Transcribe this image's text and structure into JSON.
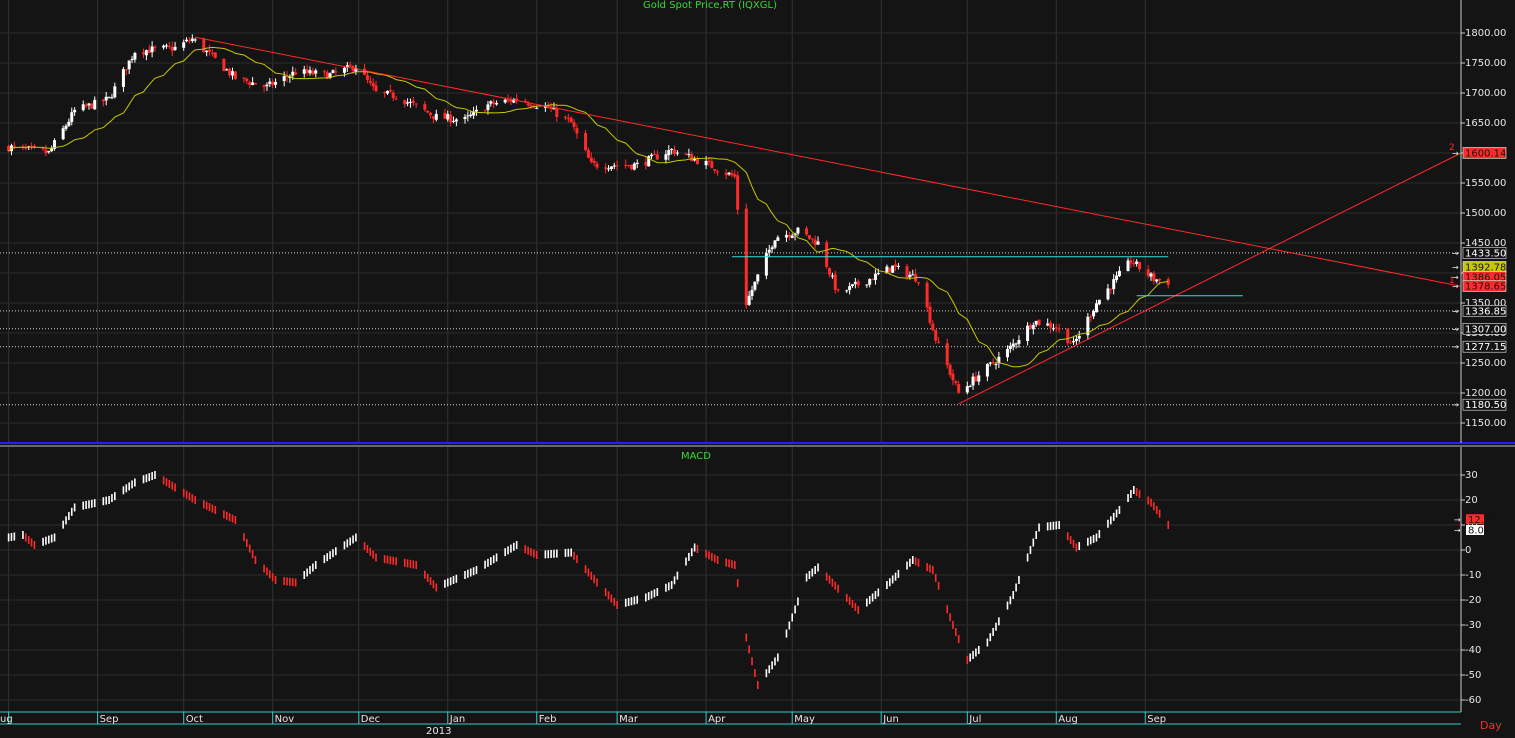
{
  "chart_data": [
    {
      "type": "candlestick",
      "title": "Gold  Spot  Price,RT  (IQXGL)",
      "ylim": [
        1110,
        1830
      ],
      "yticks": [
        1150,
        1200,
        1250,
        1300,
        1350,
        1400,
        1450,
        1500,
        1550,
        1600,
        1650,
        1700,
        1750,
        1800
      ],
      "ytick_labels": [
        "1150.00",
        "1200.00",
        "1250.00",
        "1300.00",
        "1350.00",
        "1400.00",
        "1450.00",
        "1500.00",
        "1550.00",
        "1600.00",
        "1650.00",
        "1700.00",
        "1750.00",
        "1800.00"
      ],
      "x_months": [
        "Aug",
        "Sep",
        "Oct",
        "Nov",
        "Dec",
        "Jan",
        "Feb",
        "Mar",
        "Apr",
        "May",
        "Jun",
        "Jul",
        "Aug",
        "Sep"
      ],
      "year_label": "2013",
      "moving_average_color": "#c8c800",
      "up_color": "#ffffff",
      "down_color": "#ff2a2a",
      "trendline_color": "#ff2a2a",
      "level_line_color": "#33dddd",
      "key_points": [
        {
          "date": "2012-08-01",
          "close": 1610
        },
        {
          "date": "2012-08-15",
          "close": 1600
        },
        {
          "date": "2012-08-24",
          "close": 1670
        },
        {
          "date": "2012-09-05",
          "close": 1690
        },
        {
          "date": "2012-09-14",
          "close": 1770
        },
        {
          "date": "2012-09-28",
          "close": 1775
        },
        {
          "date": "2012-10-04",
          "close": 1790
        },
        {
          "date": "2012-10-19",
          "close": 1725
        },
        {
          "date": "2012-10-30",
          "close": 1710
        },
        {
          "date": "2012-11-09",
          "close": 1735
        },
        {
          "date": "2012-11-21",
          "close": 1730
        },
        {
          "date": "2012-11-30",
          "close": 1745
        },
        {
          "date": "2012-12-07",
          "close": 1700
        },
        {
          "date": "2012-12-14",
          "close": 1695
        },
        {
          "date": "2012-12-28",
          "close": 1660
        },
        {
          "date": "2013-01-07",
          "close": 1655
        },
        {
          "date": "2013-01-15",
          "close": 1680
        },
        {
          "date": "2013-01-25",
          "close": 1690
        },
        {
          "date": "2013-02-05",
          "close": 1675
        },
        {
          "date": "2013-02-13",
          "close": 1650
        },
        {
          "date": "2013-02-20",
          "close": 1580
        },
        {
          "date": "2013-02-28",
          "close": 1580
        },
        {
          "date": "2013-03-08",
          "close": 1580
        },
        {
          "date": "2013-03-20",
          "close": 1605
        },
        {
          "date": "2013-04-02",
          "close": 1580
        },
        {
          "date": "2013-04-11",
          "close": 1560
        },
        {
          "date": "2013-04-15",
          "close": 1350
        },
        {
          "date": "2013-04-25",
          "close": 1460
        },
        {
          "date": "2013-05-03",
          "close": 1470
        },
        {
          "date": "2013-05-10",
          "close": 1450
        },
        {
          "date": "2013-05-17",
          "close": 1365
        },
        {
          "date": "2013-05-28",
          "close": 1390
        },
        {
          "date": "2013-06-05",
          "close": 1410
        },
        {
          "date": "2013-06-14",
          "close": 1390
        },
        {
          "date": "2013-06-20",
          "close": 1290
        },
        {
          "date": "2013-06-28",
          "close": 1200
        },
        {
          "date": "2013-07-05",
          "close": 1230
        },
        {
          "date": "2013-07-15",
          "close": 1270
        },
        {
          "date": "2013-07-24",
          "close": 1320
        },
        {
          "date": "2013-08-01",
          "close": 1310
        },
        {
          "date": "2013-08-07",
          "close": 1280
        },
        {
          "date": "2013-08-15",
          "close": 1350
        },
        {
          "date": "2013-08-27",
          "close": 1420
        },
        {
          "date": "2013-09-04",
          "close": 1390
        },
        {
          "date": "2013-09-09",
          "close": 1385
        }
      ],
      "trendlines": [
        {
          "label": "1",
          "from": {
            "date": "2012-10-05",
            "value": 1793
          },
          "to": {
            "date": "2013-12-20",
            "value": 1378
          },
          "end_label": "1"
        },
        {
          "label": "2",
          "from": {
            "date": "2013-06-28",
            "value": 1182
          },
          "to": {
            "date": "2013-12-20",
            "value": 1600
          },
          "end_label": "2"
        }
      ],
      "horizontal_levels": [
        {
          "value": 1433.5,
          "label": "1433.50",
          "style": "dotted",
          "box_fill": "#141414",
          "box_text": "#ffffff"
        },
        {
          "value": 1336.85,
          "label": "1336.85",
          "style": "dotted",
          "box_fill": "#141414",
          "box_text": "#ffffff"
        },
        {
          "value": 1307.0,
          "label": "1307.00",
          "style": "dotted",
          "box_fill": "#141414",
          "box_text": "#ffffff"
        },
        {
          "value": 1277.15,
          "label": "1277.15",
          "style": "dotted",
          "box_fill": "#141414",
          "box_text": "#ffffff"
        },
        {
          "value": 1180.5,
          "label": "1180.50",
          "style": "dotted",
          "box_fill": "#141414",
          "box_text": "#ffffff"
        }
      ],
      "cyan_levels": [
        {
          "value": 1427,
          "from": "2013-04-10",
          "to": "2013-09-09"
        },
        {
          "value": 1362,
          "from": "2013-08-29",
          "to": "2013-10-05"
        }
      ],
      "value_tags": [
        {
          "value": 1600.14,
          "label": "1600.14",
          "fill": "#ff2a2a",
          "text": "#141414"
        },
        {
          "value": 1392.78,
          "label": "1392.78",
          "fill": "#c8c800",
          "text": "#141414"
        },
        {
          "value": 1386.05,
          "label": "1386.05",
          "fill": "#ff2a2a",
          "text": "#141414"
        },
        {
          "value": 1378.65,
          "label": "1378.65",
          "fill": "#ff2a2a",
          "text": "#141414"
        }
      ]
    },
    {
      "type": "bar",
      "title": "MACD",
      "ylim": [
        -66,
        38
      ],
      "yticks": [
        -60,
        -50,
        -40,
        -30,
        -20,
        -10,
        0,
        10,
        20,
        30
      ],
      "ytick_labels": [
        "-60",
        "-50",
        "-40",
        "-30",
        "-20",
        "-10",
        "0",
        "10",
        "20",
        "30"
      ],
      "up_color": "#ffffff",
      "down_color": "#ff2a2a",
      "key_points": [
        {
          "date": "2012-08-01",
          "value": 5
        },
        {
          "date": "2012-08-06",
          "value": 6
        },
        {
          "date": "2012-08-10",
          "value": 2
        },
        {
          "date": "2012-08-17",
          "value": 5
        },
        {
          "date": "2012-08-24",
          "value": 17
        },
        {
          "date": "2012-09-05",
          "value": 20
        },
        {
          "date": "2012-09-14",
          "value": 27
        },
        {
          "date": "2012-09-21",
          "value": 30
        },
        {
          "date": "2012-10-05",
          "value": 20
        },
        {
          "date": "2012-10-19",
          "value": 12
        },
        {
          "date": "2012-10-26",
          "value": -4
        },
        {
          "date": "2012-11-02",
          "value": -12
        },
        {
          "date": "2012-11-09",
          "value": -13
        },
        {
          "date": "2012-11-16",
          "value": -6
        },
        {
          "date": "2012-11-30",
          "value": 5
        },
        {
          "date": "2012-12-07",
          "value": -3
        },
        {
          "date": "2012-12-21",
          "value": -6
        },
        {
          "date": "2012-12-28",
          "value": -15
        },
        {
          "date": "2013-01-11",
          "value": -8
        },
        {
          "date": "2013-01-25",
          "value": 2
        },
        {
          "date": "2013-02-01",
          "value": -2
        },
        {
          "date": "2013-02-13",
          "value": -1
        },
        {
          "date": "2013-02-22",
          "value": -13
        },
        {
          "date": "2013-03-01",
          "value": -22
        },
        {
          "date": "2013-03-11",
          "value": -19
        },
        {
          "date": "2013-03-20",
          "value": -14
        },
        {
          "date": "2013-03-28",
          "value": 1
        },
        {
          "date": "2013-04-05",
          "value": -4
        },
        {
          "date": "2013-04-11",
          "value": -6
        },
        {
          "date": "2013-04-15",
          "value": -35
        },
        {
          "date": "2013-04-19",
          "value": -54
        },
        {
          "date": "2013-04-26",
          "value": -43
        },
        {
          "date": "2013-05-06",
          "value": -11
        },
        {
          "date": "2013-05-10",
          "value": -7
        },
        {
          "date": "2013-05-24",
          "value": -24
        },
        {
          "date": "2013-06-03",
          "value": -14
        },
        {
          "date": "2013-06-12",
          "value": -4
        },
        {
          "date": "2013-06-19",
          "value": -8
        },
        {
          "date": "2013-06-26",
          "value": -30
        },
        {
          "date": "2013-07-01",
          "value": -44
        },
        {
          "date": "2013-07-08",
          "value": -37
        },
        {
          "date": "2013-07-17",
          "value": -18
        },
        {
          "date": "2013-07-26",
          "value": 9
        },
        {
          "date": "2013-08-02",
          "value": 10
        },
        {
          "date": "2013-08-08",
          "value": 1
        },
        {
          "date": "2013-08-15",
          "value": 5
        },
        {
          "date": "2013-08-23",
          "value": 16
        },
        {
          "date": "2013-08-28",
          "value": 24
        },
        {
          "date": "2013-09-03",
          "value": 19
        },
        {
          "date": "2013-09-09",
          "value": 10
        }
      ],
      "value_tags": [
        {
          "value": 12.3,
          "label": "12.3",
          "fill": "#ff2a2a",
          "text": "#141414"
        },
        {
          "value": 8.0,
          "label": "8.0",
          "fill": "#ffffff",
          "text": "#141414"
        }
      ]
    }
  ],
  "timeframe_label": "Day",
  "x_range": [
    "2012-07-29",
    "2013-12-20"
  ]
}
